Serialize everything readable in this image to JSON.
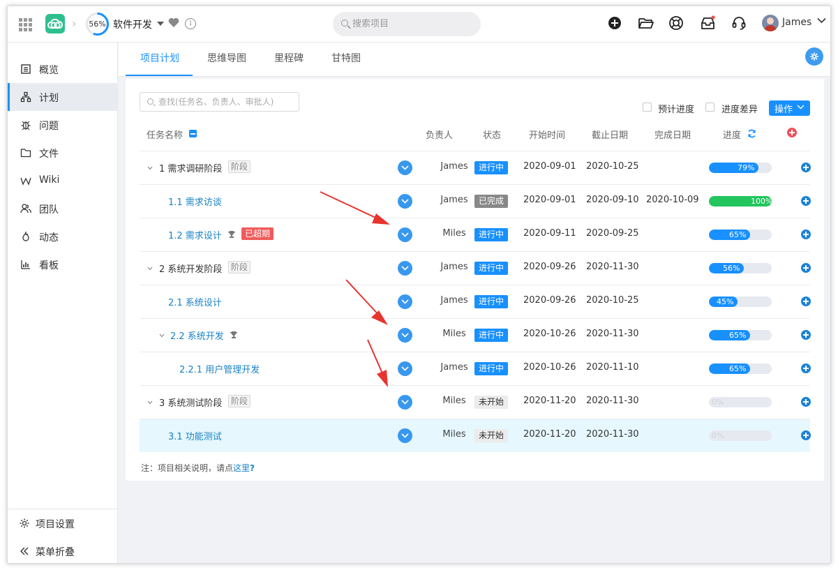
{
  "header": {
    "project_progress": "56%",
    "project_progress_value": 56,
    "project_name": "软件开发",
    "search_placeholder": "搜索项目",
    "user_name": "James",
    "icons": [
      "apps-grid-icon",
      "cloud-logo-icon",
      "add-circle-icon",
      "folder-open-icon",
      "help-lifebuoy-icon",
      "inbox-icon",
      "headset-icon",
      "chevron-down-icon"
    ]
  },
  "sidebar": {
    "items": [
      {
        "label": "概览",
        "icon": "overview-icon"
      },
      {
        "label": "计划",
        "icon": "plan-tree-icon"
      },
      {
        "label": "问题",
        "icon": "bug-icon"
      },
      {
        "label": "文件",
        "icon": "folder-icon"
      },
      {
        "label": "Wiki",
        "icon": "wiki-icon"
      },
      {
        "label": "团队",
        "icon": "team-icon"
      },
      {
        "label": "动态",
        "icon": "activity-icon"
      },
      {
        "label": "看板",
        "icon": "board-chart-icon"
      }
    ],
    "active_index": 1,
    "settings_label": "项目设置",
    "collapse_label": "菜单折叠"
  },
  "tabs": [
    {
      "label": "项目计划"
    },
    {
      "label": "思维导图"
    },
    {
      "label": "里程碑"
    },
    {
      "label": "甘特图"
    }
  ],
  "toolbar": {
    "find_placeholder": "查找(任务名、负责人、审批人)",
    "expected_progress_label": "预计进度",
    "progress_diff_label": "进度差异",
    "operation_label": "操作"
  },
  "table": {
    "headers": {
      "name": "任务名称",
      "owner": "负责人",
      "status": "状态",
      "start": "开始时间",
      "deadline": "截止日期",
      "finished": "完成日期",
      "progress": "进度"
    },
    "rows": [
      {
        "name": "1 需求调研阶段",
        "phase_tag": "阶段",
        "owner": "James",
        "status": "进行中",
        "start": "2020-09-01",
        "deadline": "2020-10-25",
        "finished": "",
        "progress": "79%",
        "progress_value": 79
      },
      {
        "name": "1.1 需求访谈",
        "owner": "James",
        "status": "已完成",
        "start": "2020-09-01",
        "deadline": "2020-09-10",
        "finished": "2020-10-09",
        "progress": "100%",
        "progress_value": 100
      },
      {
        "name": "1.2 需求设计",
        "overdue_tag": "已超期",
        "owner": "Miles",
        "status": "进行中",
        "start": "2020-09-11",
        "deadline": "2020-09-25",
        "finished": "",
        "progress": "65%",
        "progress_value": 65
      },
      {
        "name": "2 系统开发阶段",
        "phase_tag": "阶段",
        "owner": "James",
        "status": "进行中",
        "start": "2020-09-26",
        "deadline": "2020-11-30",
        "finished": "",
        "progress": "56%",
        "progress_value": 56
      },
      {
        "name": "2.1 系统设计",
        "owner": "James",
        "status": "进行中",
        "start": "2020-09-26",
        "deadline": "2020-10-25",
        "finished": "",
        "progress": "45%",
        "progress_value": 45
      },
      {
        "name": "2.2 系统开发",
        "owner": "Miles",
        "status": "进行中",
        "start": "2020-10-26",
        "deadline": "2020-11-30",
        "finished": "",
        "progress": "65%",
        "progress_value": 65
      },
      {
        "name": "2.2.1 用户管理开发",
        "owner": "James",
        "status": "进行中",
        "start": "2020-10-26",
        "deadline": "2020-11-10",
        "finished": "",
        "progress": "65%",
        "progress_value": 65
      },
      {
        "name": "3 系统测试阶段",
        "phase_tag": "阶段",
        "owner": "Miles",
        "status": "未开始",
        "start": "2020-11-20",
        "deadline": "2020-11-30",
        "finished": "",
        "progress": "0%",
        "progress_value": 0
      },
      {
        "name": "3.1 功能测试",
        "owner": "Miles",
        "status": "未开始",
        "start": "2020-11-20",
        "deadline": "2020-11-30",
        "finished": "",
        "progress": "0%",
        "progress_value": 0
      }
    ]
  },
  "footer_note": {
    "text": "注：项目相关说明，请点",
    "link": "这里",
    "suffix": "?"
  },
  "colors": {
    "accent": "#1890ff",
    "done": "#22c55e",
    "overdue": "#f05b5b",
    "annotation_arrow": "#e8332f"
  }
}
